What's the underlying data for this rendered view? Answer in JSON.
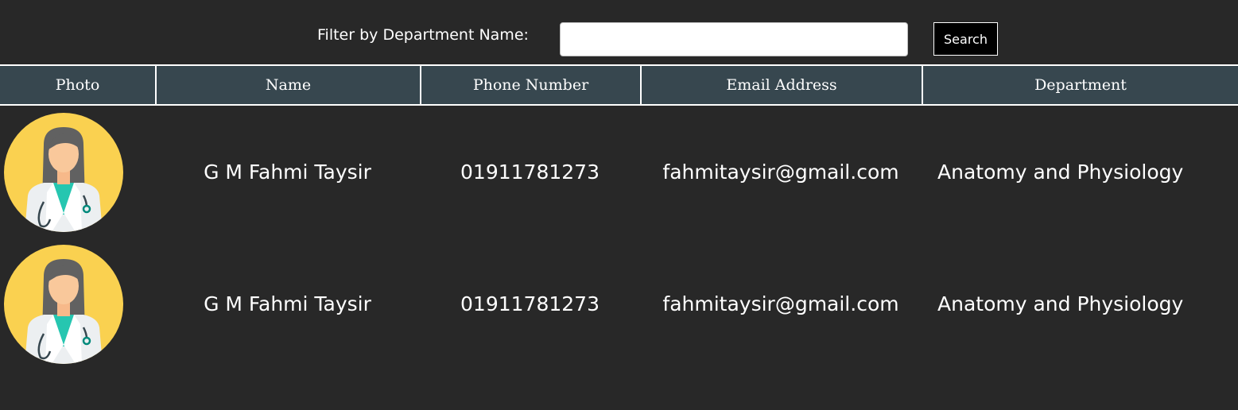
{
  "filter": {
    "label": "Filter by Department Name:",
    "input_value": "",
    "placeholder": "",
    "button_label": "Search"
  },
  "table": {
    "headers": {
      "photo": "Photo",
      "name": "Name",
      "phone": "Phone Number",
      "email": "Email Address",
      "department": "Department"
    },
    "rows": [
      {
        "photo_icon": "doctor-avatar-icon",
        "name": "G M Fahmi Taysir",
        "phone": "01911781273",
        "email": "fahmitaysir@gmail.com",
        "department": "Anatomy and Physiology"
      },
      {
        "photo_icon": "doctor-avatar-icon",
        "name": "G M Fahmi Taysir",
        "phone": "01911781273",
        "email": "fahmitaysir@gmail.com",
        "department": "Anatomy and Physiology"
      }
    ]
  },
  "colors": {
    "background": "#282828",
    "header_background": "#37474f",
    "avatar_background": "#fad150"
  }
}
